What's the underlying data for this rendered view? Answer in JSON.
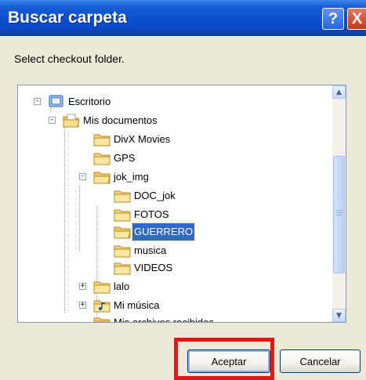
{
  "window": {
    "title": "Buscar carpeta",
    "help_label": "?",
    "close_label": "X"
  },
  "instruction": "Select checkout folder.",
  "tree": {
    "items": [
      {
        "label": "Escritorio",
        "icon": "desktop-icon",
        "expander": "-"
      },
      {
        "label": "Mis documentos",
        "icon": "open-folder-icon",
        "expander": "-"
      },
      {
        "label": "DivX Movies",
        "icon": "folder-icon"
      },
      {
        "label": "GPS",
        "icon": "folder-icon"
      },
      {
        "label": "jok_img",
        "icon": "open-folder-icon",
        "expander": "-"
      },
      {
        "label": "DOC_jok",
        "icon": "folder-icon"
      },
      {
        "label": "FOTOS",
        "icon": "folder-icon"
      },
      {
        "label": "GUERRERO",
        "icon": "open-folder-icon",
        "selected": true
      },
      {
        "label": "musica",
        "icon": "folder-icon"
      },
      {
        "label": "VIDEOS",
        "icon": "folder-icon"
      },
      {
        "label": "lalo",
        "icon": "folder-icon",
        "expander": "+"
      },
      {
        "label": "Mi música",
        "icon": "music-folder-icon",
        "expander": "+"
      },
      {
        "label": "Mis archivos recibidos",
        "icon": "folder-icon"
      }
    ]
  },
  "buttons": {
    "ok": "Aceptar",
    "cancel": "Cancelar"
  },
  "colors": {
    "titlebar": "#0a4fd0",
    "selection": "#316ac5",
    "highlight": "#e01818",
    "folder": "#f5d67b"
  }
}
